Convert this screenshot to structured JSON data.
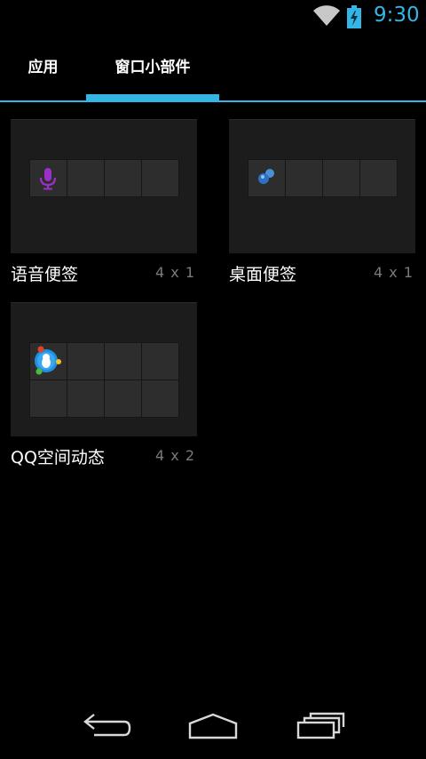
{
  "status_bar": {
    "time": "9:30",
    "icons": [
      "wifi-icon",
      "battery-charging-icon"
    ],
    "accent_color": "#33b5e5"
  },
  "tabs": [
    {
      "label": "应用",
      "selected": false
    },
    {
      "label": "窗口小部件",
      "selected": true
    }
  ],
  "widgets": [
    {
      "name": "语音便签",
      "size": "4 x 1",
      "icon": "microphone-icon",
      "icon_color": "#9b30c8"
    },
    {
      "name": "桌面便签",
      "size": "4 x 1",
      "icon": "blue-dots-icon",
      "icon_color": "#3a7bd5"
    },
    {
      "name": "QQ空间动态",
      "size": "4 x 2",
      "icon": "qzone-icon",
      "icon_color": "#1f8fe0"
    }
  ],
  "nav_bar": {
    "buttons": [
      "back-icon",
      "home-icon",
      "recent-apps-icon"
    ]
  }
}
